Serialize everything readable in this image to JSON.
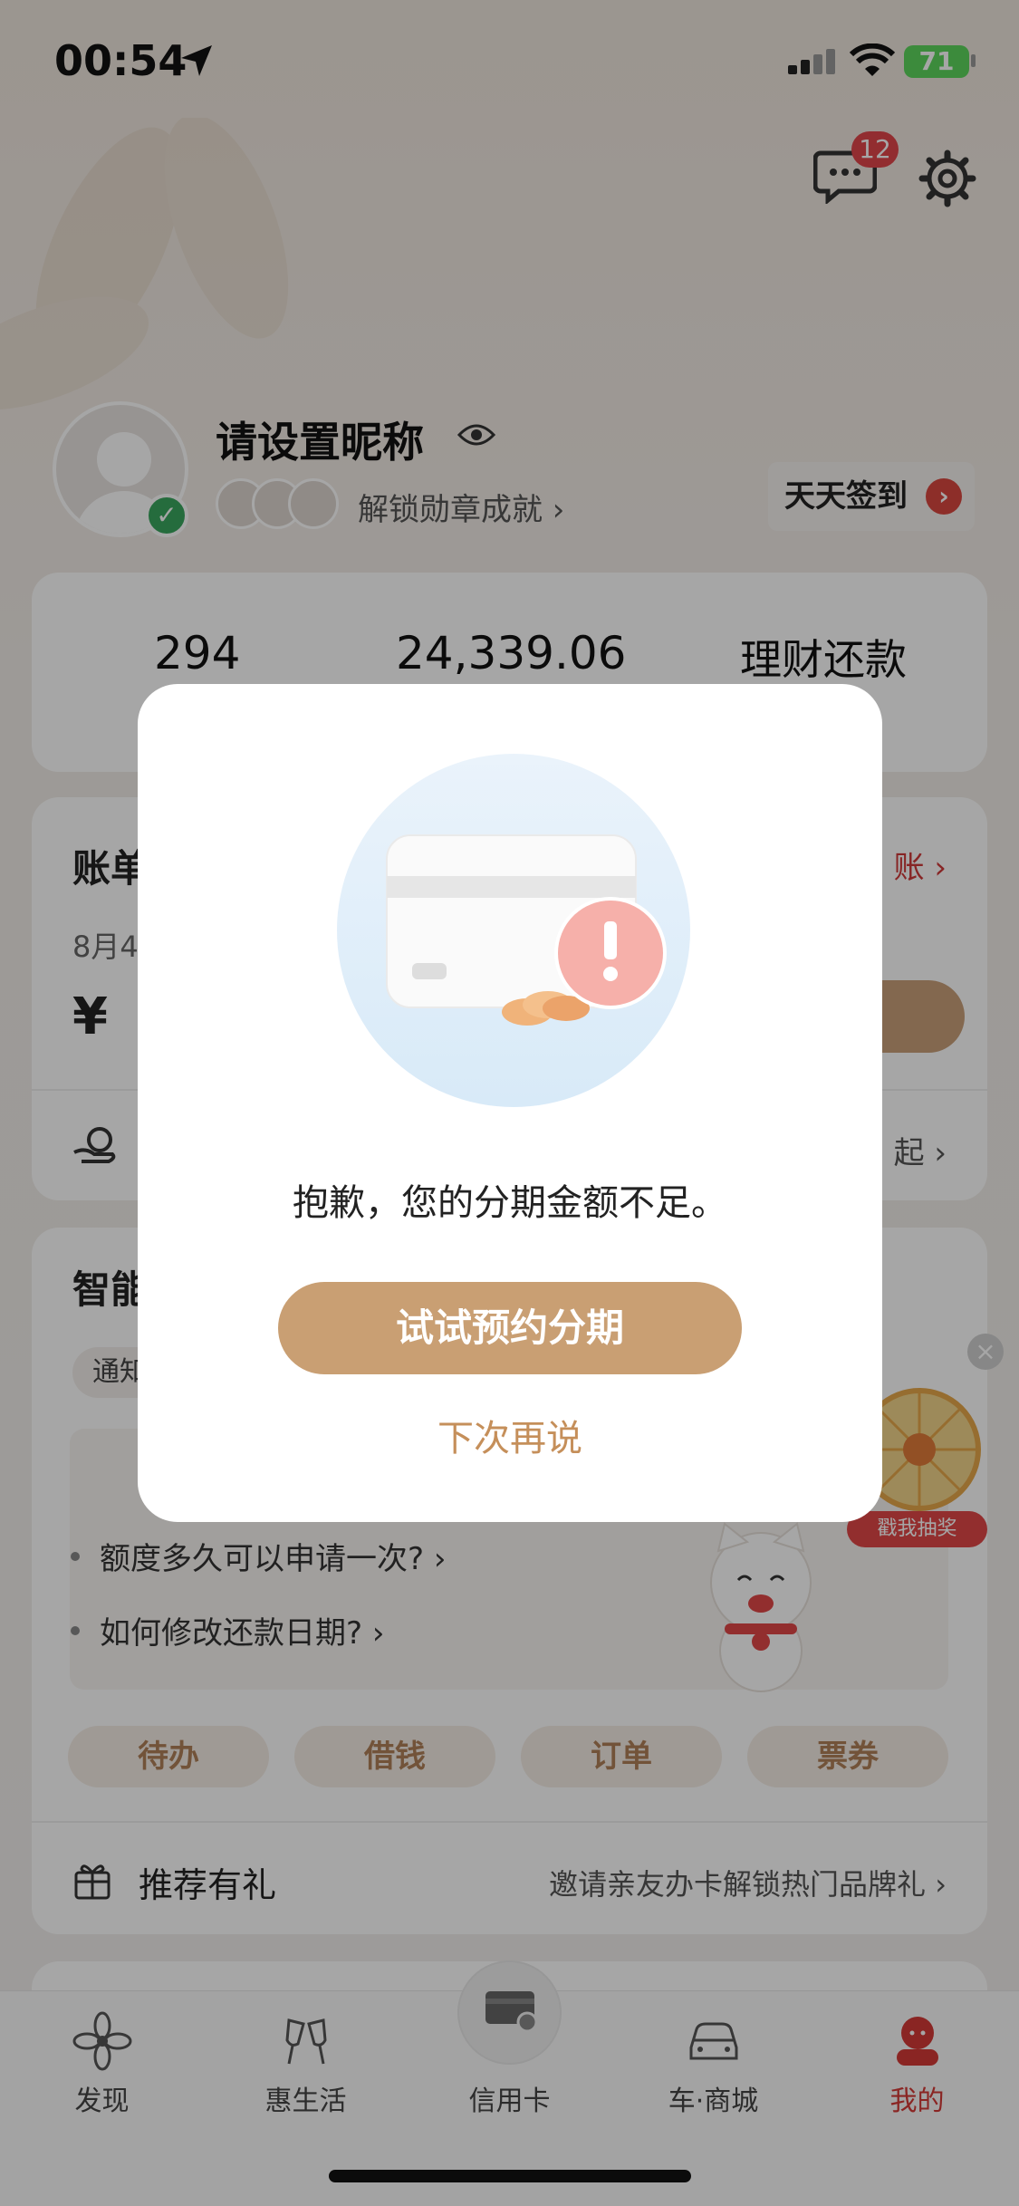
{
  "status_bar": {
    "time": "00:54",
    "battery": "71"
  },
  "header": {
    "message_badge": "12"
  },
  "profile": {
    "nickname": "请设置昵称",
    "medals_label": "解锁勋章成就 ›",
    "checkin_label": "天天签到"
  },
  "stats": {
    "points": "294",
    "amount": "24,339.06",
    "finance": "理财还款"
  },
  "bill": {
    "title": "账单",
    "date": "8月4",
    "yen": "¥",
    "right_link": "账 ›",
    "sub_right": "起 ›"
  },
  "smart": {
    "title": "智能",
    "notify_chip": "通知",
    "faq": [
      "额度多久可以申请一次? ›",
      "如何修改还款日期? ›"
    ],
    "pills": [
      "待办",
      "借钱",
      "订单",
      "票券"
    ],
    "recommend": "推荐有礼",
    "invite": "邀请亲友办卡解锁热门品牌礼 ›"
  },
  "lottery": {
    "label": "戳我抽奖"
  },
  "nav": [
    {
      "label": "发现",
      "icon": "discover-icon"
    },
    {
      "label": "惠生活",
      "icon": "cheers-icon"
    },
    {
      "label": "信用卡",
      "icon": "credit-card-icon"
    },
    {
      "label": "车·商城",
      "icon": "car-icon"
    },
    {
      "label": "我的",
      "icon": "me-icon"
    }
  ],
  "modal": {
    "message": "抱歉，您的分期金额不足。",
    "primary": "试试预约分期",
    "secondary": "下次再说"
  },
  "colors": {
    "accent": "#c99f73",
    "active": "#d43a36",
    "badge": "#e0454a"
  }
}
